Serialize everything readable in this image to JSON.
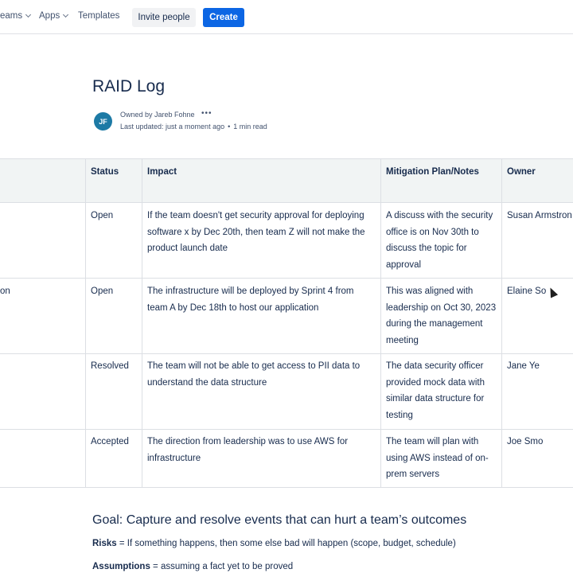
{
  "nav": {
    "teams": "eams",
    "apps": "Apps",
    "templates": "Templates",
    "invite": "Invite people",
    "create": "Create"
  },
  "page": {
    "title": "RAID Log",
    "avatar_initials": "JF",
    "owned_by": "Owned by Jareb Fohne",
    "last_updated": "Last updated: just a moment ago",
    "read_time": "1 min read"
  },
  "table": {
    "headers": [
      "Status",
      "Impact",
      "Mitigation Plan/Notes",
      "Owner"
    ],
    "rows": [
      {
        "left": "",
        "status": "Open",
        "impact": "If the team doesn't get security approval for deploying  software x by Dec 20th, then team Z will not make the product launch date",
        "mitigation": "A discuss with the security office is on Nov 30th to discuss the topic for approval",
        "owner": "Susan Armstron"
      },
      {
        "left": "on",
        "status": "Open",
        "impact": "The infrastructure will be deployed by Sprint 4 from team A by Dec 18th to host our application",
        "mitigation": "This was aligned with leadership on Oct 30, 2023 during the management meeting",
        "owner": "Elaine So"
      },
      {
        "left": "",
        "status": "Resolved",
        "impact": "The team will not be able to get access to PII data to understand the data structure",
        "mitigation": "The data security officer provided mock data with similar data structure for testing",
        "owner": "Jane Ye"
      },
      {
        "left": "",
        "status": "Accepted",
        "impact": "The direction from leadership was to use AWS for infrastructure",
        "mitigation": "The team will plan with using AWS instead of on-prem servers",
        "owner": "Joe Smo"
      }
    ]
  },
  "notes": {
    "goal": "Goal: Capture and resolve events that can hurt a team’s outcomes",
    "risks_term": "Risks",
    "risks_def": " = If something happens, then some else bad will happen (scope, budget, schedule)",
    "assumptions_term": "Assumptions",
    "assumptions_def": " = assuming a fact yet to be proved"
  }
}
